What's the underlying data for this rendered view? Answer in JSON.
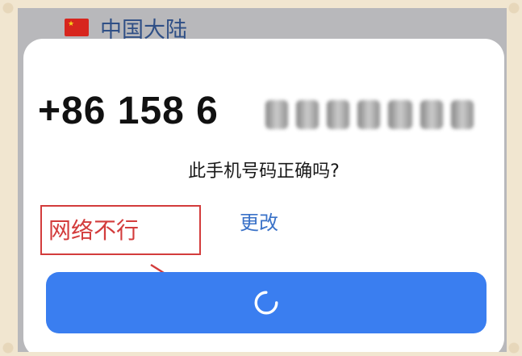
{
  "header": {
    "country_icon": "china-flag-icon",
    "country_name": "中国大陆"
  },
  "dialog": {
    "phone_number_prefix": "+86 158 6",
    "phone_number_obscured": true,
    "question": "此手机号码正确吗?",
    "change_link_label": "更改",
    "primary_button": {
      "state": "loading",
      "icon": "spinner-icon"
    }
  },
  "annotation": {
    "text": "网络不行",
    "color": "#d33c3c"
  },
  "colors": {
    "accent": "#3a7ef0",
    "link": "#3a72c8"
  }
}
